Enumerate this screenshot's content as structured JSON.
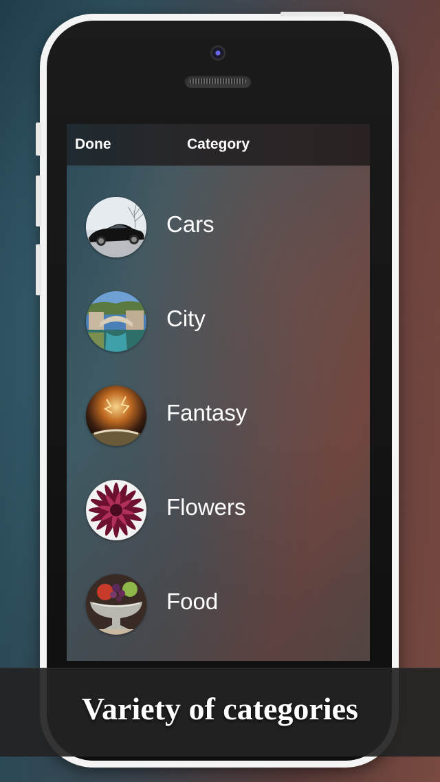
{
  "navbar": {
    "done_label": "Done",
    "title": "Category"
  },
  "categories": [
    {
      "label": "Cars",
      "icon": "cars-thumbnail"
    },
    {
      "label": "City",
      "icon": "city-thumbnail"
    },
    {
      "label": "Fantasy",
      "icon": "fantasy-thumbnail"
    },
    {
      "label": "Flowers",
      "icon": "flowers-thumbnail"
    },
    {
      "label": "Food",
      "icon": "food-thumbnail"
    }
  ],
  "caption": "Variety of categories",
  "colors": {
    "background_left": "#1e3a48",
    "background_right": "#7a4a40",
    "phone_body": "#f4f4f4",
    "text": "#ffffff",
    "caption_band": "#232323"
  }
}
